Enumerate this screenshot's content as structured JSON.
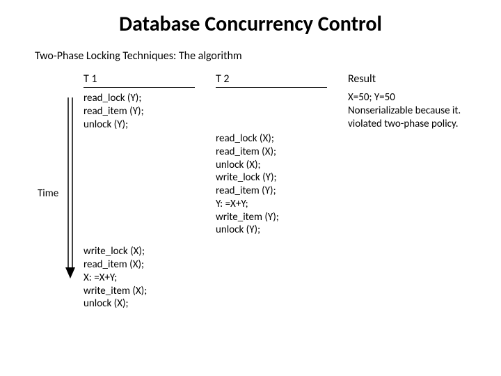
{
  "title": "Database Concurrency Control",
  "subtitle": "Two-Phase Locking Techniques: The algorithm",
  "headers": {
    "t1": "T 1",
    "t2": "T 2",
    "result": "Result"
  },
  "t1": {
    "block1": "read_lock (Y);\nread_item (Y);\nunlock (Y);",
    "block2": "write_lock (X);\nread_item (X);\nX: =X+Y;\nwrite_item (X);\nunlock (X);"
  },
  "t2": {
    "block1": "read_lock (X);\nread_item (X);\nunlock (X);\nwrite_lock (Y);\nread_item (Y);\nY: =X+Y;\nwrite_item (Y);\nunlock (Y);"
  },
  "result": {
    "text": "X=50; Y=50\nNonserializable because it.\nviolated two-phase policy."
  },
  "time_label": "Time"
}
